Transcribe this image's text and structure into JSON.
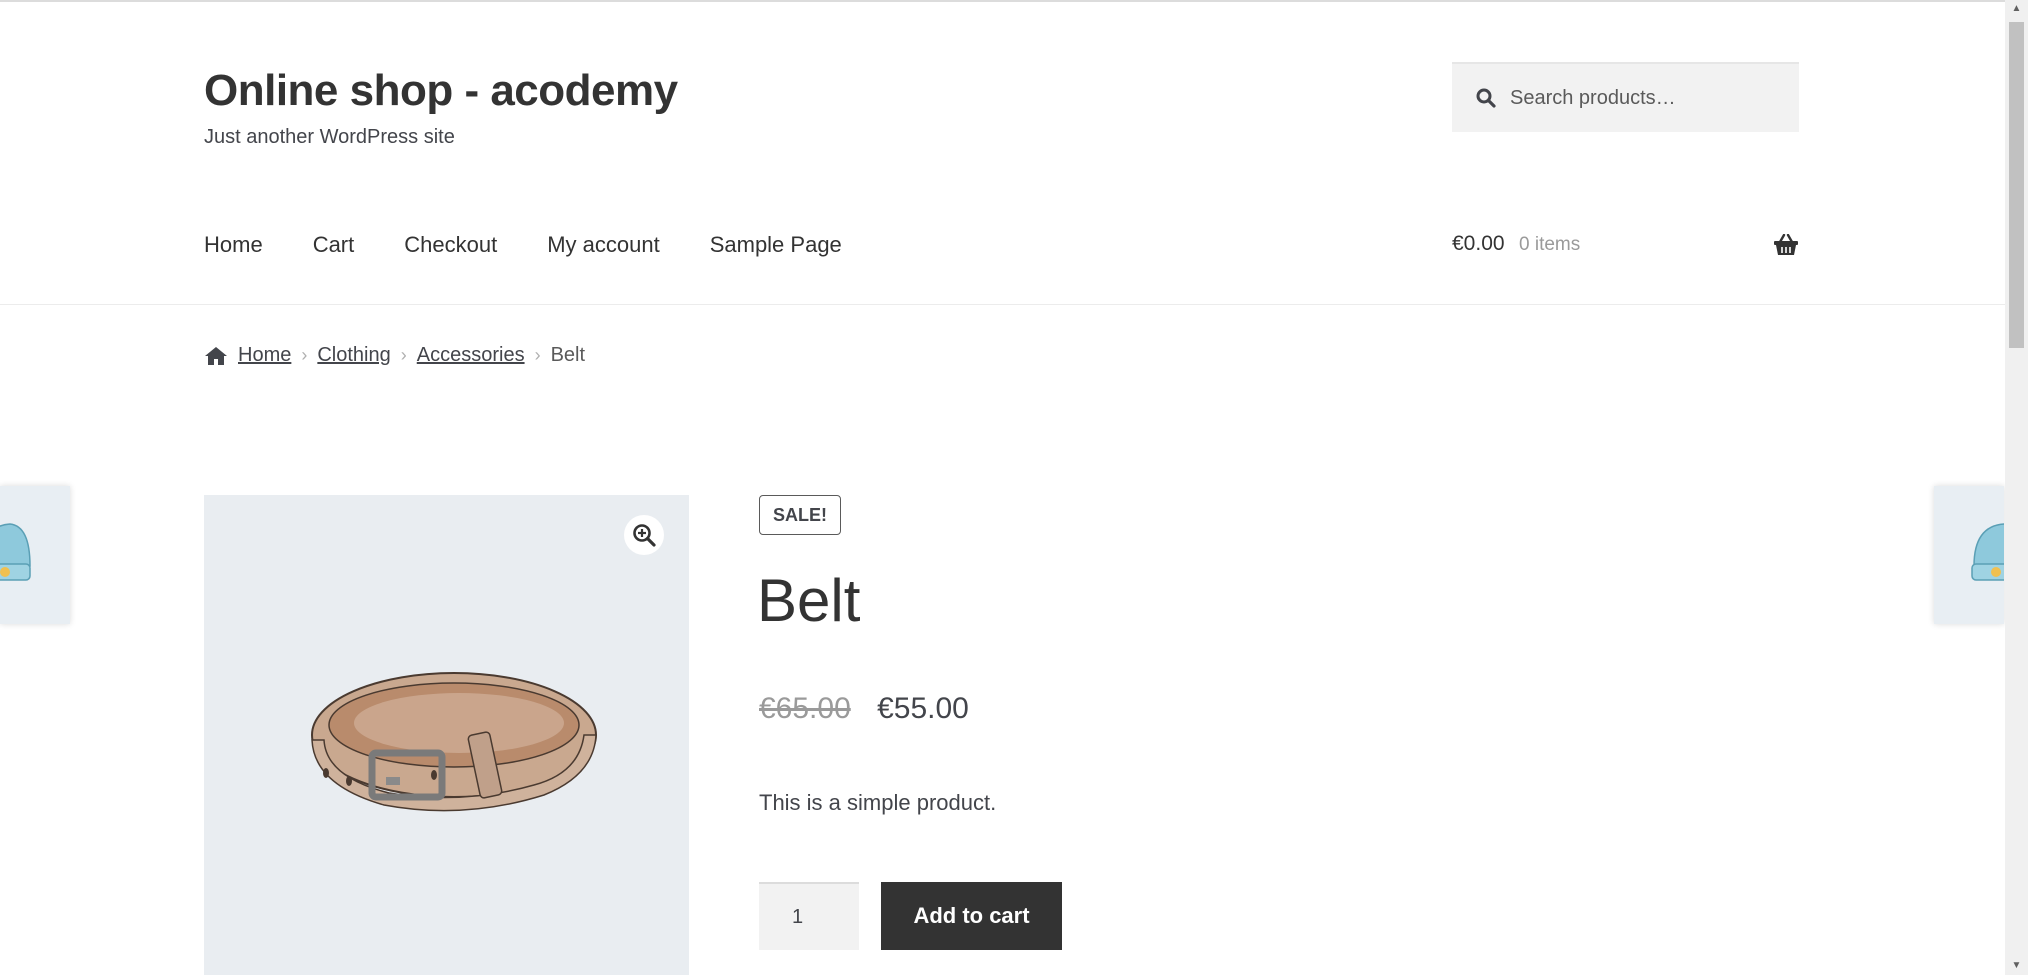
{
  "site": {
    "title": "Online shop - acodemy",
    "tagline": "Just another WordPress site"
  },
  "search": {
    "placeholder": "Search products…"
  },
  "nav": {
    "items": [
      "Home",
      "Cart",
      "Checkout",
      "My account",
      "Sample Page"
    ]
  },
  "cart": {
    "amount": "€0.00",
    "count": "0 items"
  },
  "breadcrumb": {
    "items": [
      "Home",
      "Clothing",
      "Accessories"
    ],
    "current": "Belt"
  },
  "product": {
    "sale_badge": "SALE!",
    "title": "Belt",
    "old_price": "€65.00",
    "price": "€55.00",
    "short_description": "This is a simple product.",
    "quantity": "1",
    "add_to_cart_label": "Add to cart"
  },
  "colors": {
    "primary_dark": "#333333",
    "text": "#43454b",
    "gallery_bg": "#e9edf1"
  }
}
